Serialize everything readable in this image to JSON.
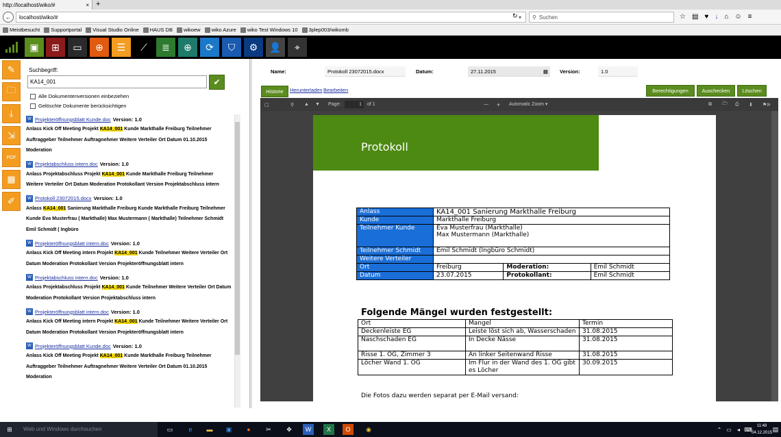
{
  "browser": {
    "tab_title": "http://localhost/wiko/#",
    "url": "localhost/wiko/#",
    "search_placeholder": "Suchen",
    "bookmarks": [
      "Meistbesucht",
      "Supportportal",
      "Visual Studio Online",
      "HAUS DB",
      "wikoew",
      "wiko Azure",
      "wiko Test Windows 10",
      "3plep003/wikomb"
    ]
  },
  "toolbar_icons": [
    "logo-bars-icon",
    "documents-icon",
    "org-chart-icon",
    "toolbox-icon",
    "globe-icon",
    "task-list-icon",
    "line-chart-icon",
    "list-chart-icon",
    "web-globe-icon",
    "sync-icon",
    "shield-icon",
    "gear-icon",
    "user-icon",
    "navigation-icon"
  ],
  "left_strip_icons": [
    "document-edit-icon",
    "folder-search-icon",
    "document-download-icon",
    "document-export-icon",
    "pdf-icon",
    "document-calendar-icon",
    "document-pencil-icon"
  ],
  "search": {
    "label": "Suchbegriff:",
    "value": "KA14_001",
    "include_versions": "Alle Dokumentenversionen einbeziehen",
    "include_deleted": "Gelöschte Dokumente berücksichtigen"
  },
  "results": [
    {
      "title": "Projekteröffnungsblatt Kunde.doc",
      "version": "Version: 1.0",
      "pre": "Anlass Kick Off Meeting Projekt ",
      "hl": "KA14_001",
      "post": " Kunde Markthalle Freiburg Teilnehmer Auftraggeber Teilnehmer Auftragnehmer Weitere Verteiler Ort Datum 01.10.2015 Moderation"
    },
    {
      "title": "Projektabschluss intern.doc",
      "version": "Version: 1.0",
      "pre": "Anlass Projektabschluss Projekt ",
      "hl": "KA14_001",
      "post": " Kunde Markthalle Freiburg Teilnehmer Weitere Verteiler Ort Datum Moderation Protokollant Version Projektabschluss intern"
    },
    {
      "title": "Protokoll 23072015.docx",
      "version": "Version: 1.0",
      "pre": "Anlass ",
      "hl": "KA14_001",
      "post": " Sanierung Markthalle Freiburg Kunde Markthalle Freiburg Teilnehmer Kunde Eva Musterfrau ( Markthalle) Max Mustermann ( Markthalle) Teilnehmer Schmidt Emil Schmidt ( Ingbüro"
    },
    {
      "title": "Projekteröffnungsblatt intern.doc",
      "version": "Version: 1.0",
      "pre": "Anlass Kick Off Meeting intern Projekt ",
      "hl": "KA14_001",
      "post": " Kunde Teilnehmer Weitere Verteiler Ort Datum Moderation Protokollant Version Projekteröffnungsblatt intern"
    },
    {
      "title": "Projektabschluss intern.doc",
      "version": "Version: 1.0",
      "pre": "Anlass Projektabschluss Projekt ",
      "hl": "KA14_001",
      "post": " Kunde Teilnehmer Weitere Verteiler Ort Datum Moderation Protokollant Version Projektabschluss intern"
    },
    {
      "title": "Projekteröffnungsblatt intern.doc",
      "version": "Version: 1.0",
      "pre": "Anlass Kick Off Meeting intern Projekt ",
      "hl": "KA14_001",
      "post": " Kunde Teilnehmer Weitere Verteiler Ort Datum Moderation Protokollant Version Projekteröffnungsblatt intern"
    },
    {
      "title": "Projekteröffnungsblatt Kunde.doc",
      "version": "Version: 1.0",
      "pre": "Anlass Kick Off Meeting Projekt ",
      "hl": "KA14_001",
      "post": " Kunde Markthalle Freiburg Teilnehmer Auftraggeber Teilnehmer Auftragnehmer Weitere Verteiler Ort Datum 01.10.2015 Moderation"
    }
  ],
  "doc_header": {
    "name_label": "Name:",
    "name_value": "Protokoll 23072015.docx",
    "date_label": "Datum:",
    "date_value": "27.11.2015",
    "version_label": "Version:",
    "version_value": "1.0"
  },
  "actions": {
    "historie": "Historie",
    "herunterladen": "Herunterladen",
    "bearbeiten": "Bearbeiten",
    "berechtigungen": "Berechtigungen",
    "auschecken": "Auschecken",
    "loeschen": "Löschen"
  },
  "pdf": {
    "page_label": "Page:",
    "page_num": "1",
    "page_of": "of 1",
    "zoom": "Automatic Zoom",
    "minus": "—",
    "plus": "+"
  },
  "document": {
    "banner": "Protokoll",
    "anlass_h": "Anlass",
    "anlass_v": "KA14_001 Sanierung Markthalle Freiburg",
    "kunde_h": "Kunde",
    "kunde_v": "Markthalle Freiburg",
    "teilnehmer_kunde_h": "Teilnehmer Kunde",
    "teilnehmer_kunde_v1": "Eva Musterfrau (Markthalle)",
    "teilnehmer_kunde_v2": "Max Mustermann (Markthalle)",
    "teilnehmer_schmidt_h": "Teilnehmer Schmidt",
    "teilnehmer_schmidt_v": "Emil Schmidt (Ingbüro Schmidt)",
    "weitere_h": "Weitere Verteiler",
    "ort_h": "Ort",
    "ort_v": "Freiburg",
    "moderation_h": "Moderation:",
    "moderation_v": "Emil Schmidt",
    "datum_h": "Datum",
    "datum_v": "23.07.2015",
    "protokollant_h": "Protokollant:",
    "protokollant_v": "Emil Schmidt",
    "maengel_heading": "Folgende Mängel wurden festgestellt:",
    "maengel_cols": [
      "Ort",
      "Mangel",
      "Termin"
    ],
    "maengel_rows": [
      [
        "Deckenleiste EG",
        "Leiste löst sich ab, Wasserschaden",
        "31.08.2015"
      ],
      [
        "Naschschaden EG",
        "In Decke Nässe",
        "31.08.2015"
      ],
      [
        "Risse 1. OG, Zimmer 3",
        "An linker Seitenwand Risse",
        "31.08.2015"
      ],
      [
        "Löcher Wand 1. OG",
        "Im Flur in der Wand des 1. OG gibt es Löcher",
        "30.09.2015"
      ]
    ],
    "fotos": "Die Fotos dazu werden separat per E-Mail versand:"
  },
  "taskbar": {
    "search": "Web und Windows durchsuchen",
    "time": "11:48",
    "date": "04.12.2015"
  }
}
